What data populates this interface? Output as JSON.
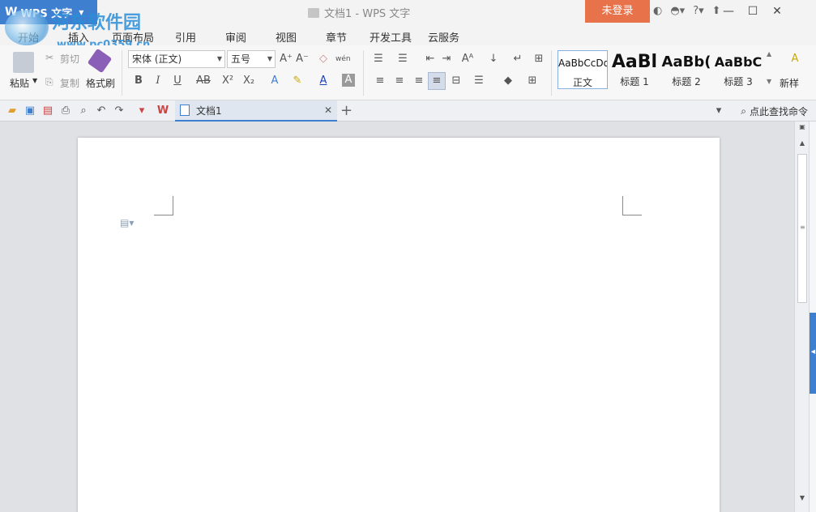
{
  "titlebar": {
    "app_menu_label": "WPS 文字",
    "doc_title": "文档1 - WPS 文字",
    "login_label": "未登录",
    "watermark_title": "河东软件园",
    "watermark_url": "www.pc0359.cn"
  },
  "menu": {
    "tabs": [
      "开始",
      "插入",
      "页面布局",
      "引用",
      "审阅",
      "视图",
      "章节",
      "开发工具",
      "云服务"
    ]
  },
  "ribbon": {
    "paste_label": "粘贴",
    "cut_label": "剪切",
    "copy_label": "复制",
    "format_painter_label": "格式刷",
    "font_name": "宋体 (正文)",
    "font_size": "五号",
    "styles": [
      {
        "sample": "AaBbCcDd",
        "label": "正文"
      },
      {
        "sample": "AaBl",
        "label": "标题 1"
      },
      {
        "sample": "AaBb(",
        "label": "标题 2"
      },
      {
        "sample": "AaBbC",
        "label": "标题 3"
      }
    ],
    "new_style_label": "新样"
  },
  "quickbar": {
    "doc_tab_label": "文档1",
    "find_label": "点此查找命令"
  }
}
